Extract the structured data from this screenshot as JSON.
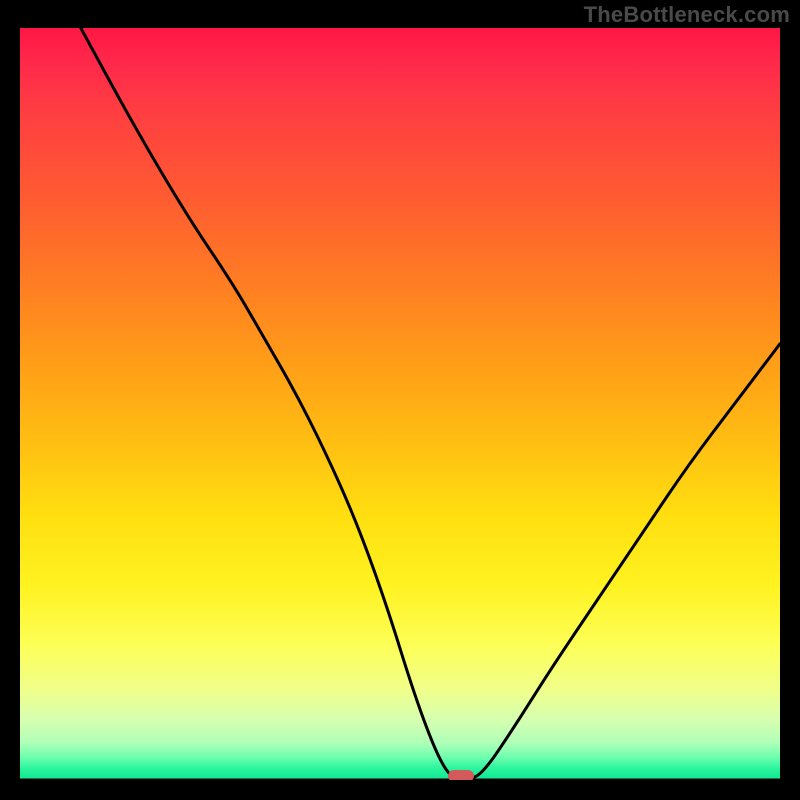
{
  "watermark": "TheBottleneck.com",
  "chart_data": {
    "type": "line",
    "title": "",
    "xlabel": "",
    "ylabel": "",
    "xlim": [
      0,
      100
    ],
    "ylim": [
      0,
      100
    ],
    "grid": false,
    "legend": false,
    "background_gradient_stops": [
      {
        "pos": 0,
        "color": "#ff1744"
      },
      {
        "pos": 5,
        "color": "#ff2a4a"
      },
      {
        "pos": 12,
        "color": "#ff4040"
      },
      {
        "pos": 22,
        "color": "#ff5a32"
      },
      {
        "pos": 33,
        "color": "#ff7a24"
      },
      {
        "pos": 44,
        "color": "#ff9c18"
      },
      {
        "pos": 55,
        "color": "#ffbe12"
      },
      {
        "pos": 65,
        "color": "#ffdf10"
      },
      {
        "pos": 74,
        "color": "#fff220"
      },
      {
        "pos": 82,
        "color": "#fdff56"
      },
      {
        "pos": 88,
        "color": "#f0ff8a"
      },
      {
        "pos": 92,
        "color": "#d6ffb0"
      },
      {
        "pos": 95,
        "color": "#b0ffb8"
      },
      {
        "pos": 97,
        "color": "#6dffae"
      },
      {
        "pos": 98.5,
        "color": "#29f59d"
      },
      {
        "pos": 100,
        "color": "#11e691"
      }
    ],
    "series": [
      {
        "name": "bottleneck-curve",
        "color": "#000000",
        "x": [
          8,
          15,
          22,
          28,
          32,
          36,
          40,
          44,
          48,
          52,
          55,
          57,
          59,
          61,
          65,
          70,
          76,
          82,
          88,
          94,
          100
        ],
        "y": [
          100,
          87,
          75,
          66,
          59,
          52,
          44,
          35,
          24,
          11,
          3,
          0,
          0,
          1,
          7,
          15,
          24,
          33,
          42,
          50,
          58
        ]
      }
    ],
    "marker": {
      "x": 58,
      "y": 0.5,
      "color": "#d35a5a"
    },
    "baseline_y": 0
  }
}
